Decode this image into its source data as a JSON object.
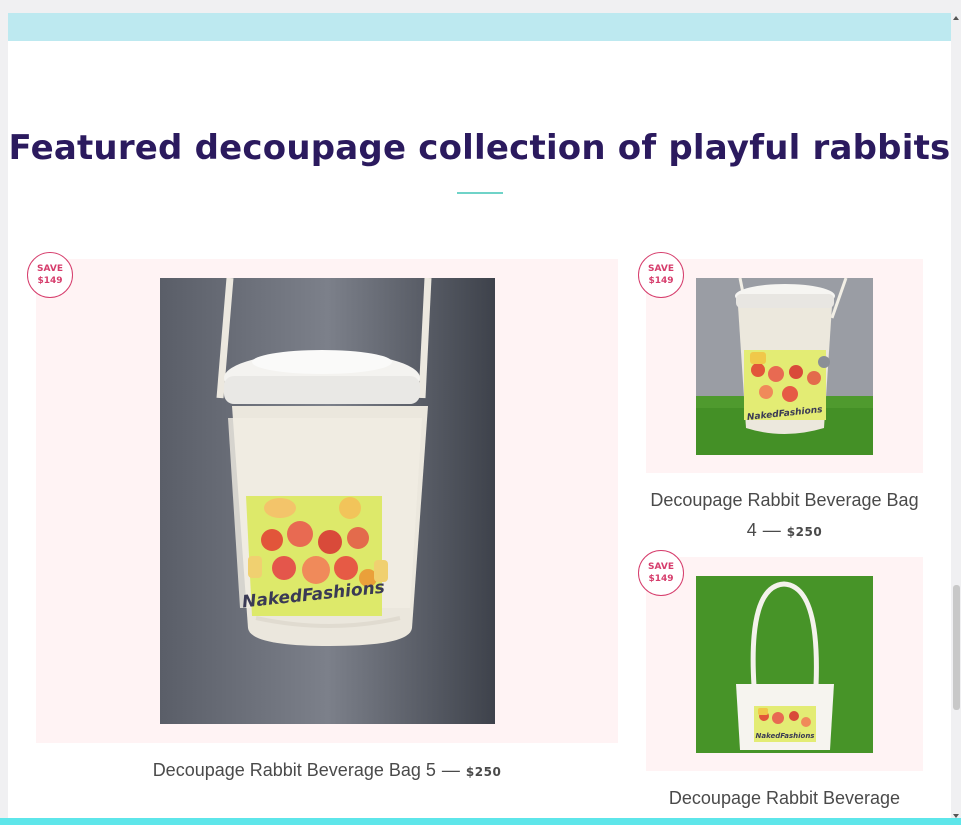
{
  "section": {
    "heading": "Featured decoupage collection of playful rabbits"
  },
  "colors": {
    "top_band": "#bde9f0",
    "heading": "#2b1a5e",
    "accent_rule": "#6fd3c8",
    "card_bg": "#fff3f4",
    "badge": "#d63d6c",
    "bottom_band": "#5ee6ea"
  },
  "products": [
    {
      "badge_line1": "SAVE",
      "badge_line2": "$149",
      "title": "Decoupage Rabbit Beverage Bag 5",
      "separator": "—",
      "price": "$250"
    },
    {
      "badge_line1": "SAVE",
      "badge_line2": "$149",
      "title": "Decoupage Rabbit Beverage Bag 4",
      "separator": "—",
      "price": "$250"
    },
    {
      "badge_line1": "SAVE",
      "badge_line2": "$149",
      "title": "Decoupage Rabbit Beverage"
    }
  ]
}
